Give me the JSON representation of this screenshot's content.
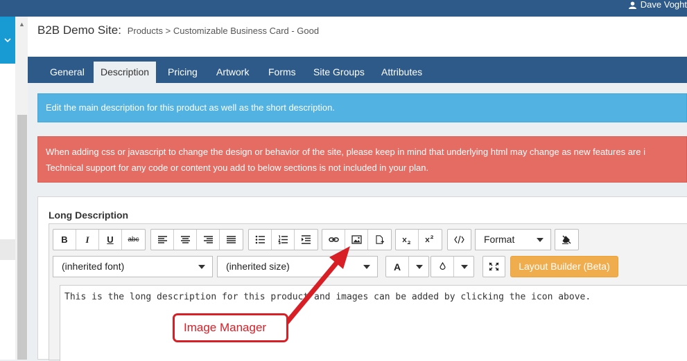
{
  "topbar": {
    "user_name": "Dave Voght"
  },
  "header": {
    "site_name": "B2B Demo Site:",
    "breadcrumb_1": "Products",
    "breadcrumb_sep": ">",
    "breadcrumb_2": "Customizable Business Card - Good"
  },
  "tabs": [
    "General",
    "Description",
    "Pricing",
    "Artwork",
    "Forms",
    "Site Groups",
    "Attributes"
  ],
  "active_tab": "Description",
  "alerts": {
    "info": "Edit the main description for this product as well as the short description.",
    "danger_line1": "When adding css or javascript to change the design or behavior of the site, please keep in mind that underlying html may change as new features are i",
    "danger_line2": "Technical support for any code or content you add to below sections is not included in your plan."
  },
  "editor": {
    "label": "Long Description",
    "format_label": "Format",
    "font_value": "(inherited font)",
    "size_value": "(inherited size)",
    "font_color_label": "A",
    "layout_builder_label": "Layout Builder (Beta)",
    "content": "This is the long description for this product and images can be added by clicking the icon above.",
    "bold": "B",
    "italic": "I",
    "underline": "U",
    "strike": "abc"
  },
  "annotation": {
    "label": "Image Manager",
    "color": "#d81f26"
  },
  "colors": {
    "brand": "#2d5a88",
    "info": "#52b3e3",
    "danger": "#e46c63",
    "warning": "#f0ad4e"
  }
}
